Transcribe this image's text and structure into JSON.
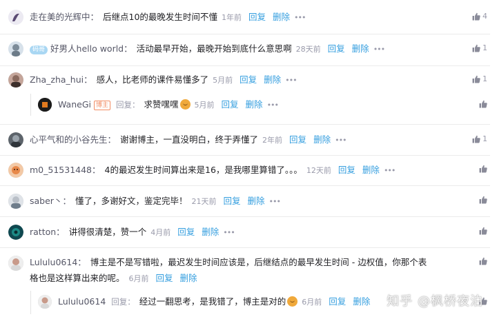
{
  "actions": {
    "reply": "回复",
    "delete": "删除",
    "reply_label": "回复：",
    "dots": "•••"
  },
  "comments": [
    {
      "name": "走在美的光辉中",
      "content": "后继点10的最晚发生时间不懂",
      "time": "1年前",
      "likes": "4"
    },
    {
      "tag": "码哥",
      "name": "好男人hello world",
      "content": "活动最早开始，最晚开始到底什么意思啊",
      "time": "28天前",
      "likes": "1"
    },
    {
      "name": "Zha_zha_hui",
      "content": "感人，比老师的课件易懂多了",
      "time": "5月前",
      "likes": "1",
      "reply": {
        "name": "WaneGi",
        "badge": "博主",
        "content": "求赞嘿嘿",
        "time": "5月前"
      }
    },
    {
      "name": "心平气和的小谷先生",
      "content": "谢谢博主，一直没明白，终于弄懂了",
      "time": "2年前",
      "likes": "1"
    },
    {
      "name": "m0_51531448",
      "content": "4的最迟发生时间算出来是16，是我哪里算错了。。。",
      "time": "12天前",
      "likes": ""
    },
    {
      "name": "saber丶",
      "content": "懂了，多谢好文，鉴定完毕！",
      "time": "21天前",
      "likes": ""
    },
    {
      "name": "ratton",
      "content": "讲得很清楚，赞一个",
      "time": "4月前",
      "likes": ""
    },
    {
      "name": "Lululu0614",
      "content_line1": "博主是不是写错啦，最迟发生时间应该是，后继结点的最早发生时间 - 边权值，你那个表",
      "content_line2": "格也是这样算出来的呢。",
      "time": "6月前",
      "likes": "",
      "reply": {
        "name": "Lululu0614",
        "content": "经过一翻思考，是我错了，博主是对的",
        "time": "6月前"
      }
    }
  ],
  "watermark": "知乎 @枫桥夜泊",
  "colors": {
    "link": "#349edf",
    "muted": "#999aaa",
    "name": "#555666",
    "text": "#222226"
  }
}
